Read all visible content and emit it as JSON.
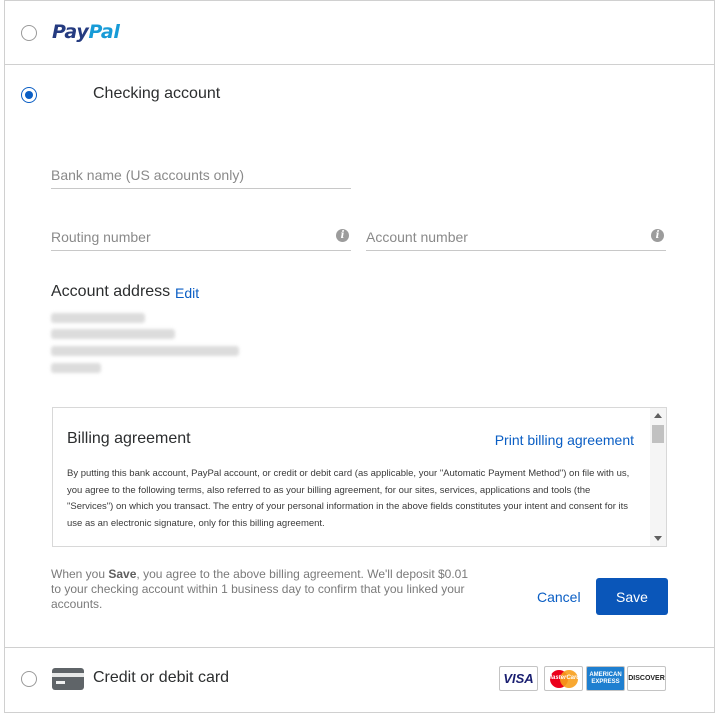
{
  "paypal": {
    "logo_pay": "Pay",
    "logo_pal": "Pal",
    "selected": false
  },
  "checking": {
    "label": "Checking account",
    "selected": true,
    "bank_name_placeholder": "Bank name (US accounts only)",
    "routing_placeholder": "Routing number",
    "account_placeholder": "Account number",
    "address_title": "Account address",
    "address_edit": "Edit",
    "agreement": {
      "title": "Billing agreement",
      "print_link": "Print billing agreement",
      "text": "By putting this bank account, PayPal account, or credit or debit card (as applicable, your \"Automatic Payment Method\") on file with us, you agree to the following terms, also referred to as your billing agreement, for our sites, services, applications and tools (the \"Services\") on which you transact. The entry of your personal information in the above fields constitutes your intent and consent for its use as an electronic signature, only for this billing agreement."
    },
    "note_prefix": "When you ",
    "note_bold": "Save",
    "note_suffix": ", you agree to the above billing agreement. We'll deposit $0.01 to your checking account within 1 business day to confirm that you linked your accounts.",
    "cancel_label": "Cancel",
    "save_label": "Save"
  },
  "card": {
    "label": "Credit or debit card",
    "selected": false,
    "brands": {
      "visa": "VISA",
      "mastercard": "MasterCard",
      "amex": "AMERICAN EXPRESS",
      "discover": "DISCOVER"
    }
  },
  "colors": {
    "link": "#0a5ec4",
    "primary_button": "#0a56b9"
  }
}
